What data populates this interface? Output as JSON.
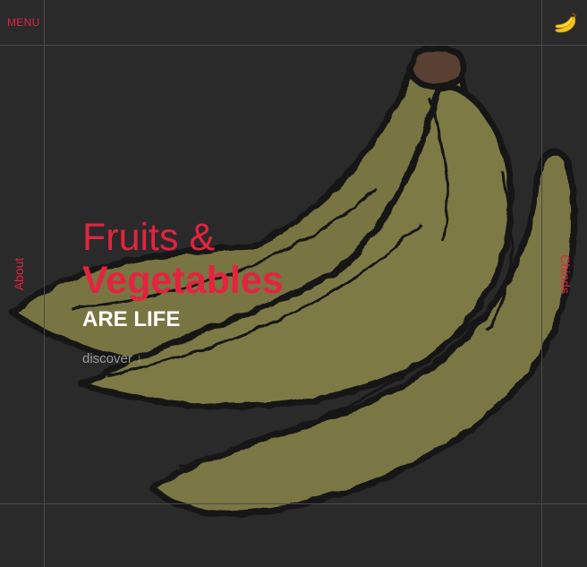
{
  "header": {
    "menu_label": "MENU",
    "logo_icon": "banana-icon"
  },
  "side_nav": {
    "left_label": "About",
    "right_label": "Chinds"
  },
  "hero": {
    "line1": "Fruits &",
    "line2": "Vegetables",
    "line3": "ARE LIFE",
    "cta": "discover ↓"
  },
  "colors": {
    "background": "#2a2a2a",
    "accent": "#e4233f",
    "banana": "#7b7842",
    "banana_outline": "#141414",
    "stem": "#5a4032"
  }
}
